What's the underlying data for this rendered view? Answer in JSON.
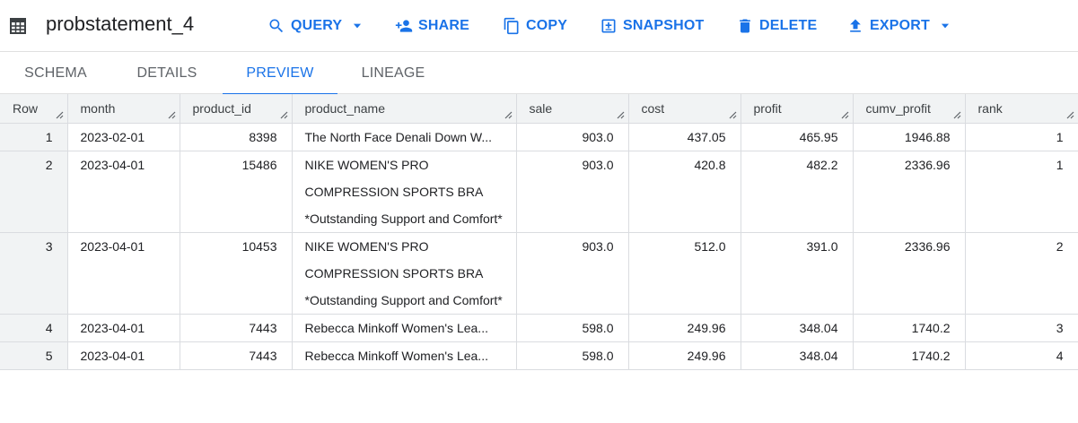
{
  "toolbar": {
    "title": "probstatement_4",
    "query_label": "QUERY",
    "share_label": "SHARE",
    "copy_label": "COPY",
    "snapshot_label": "SNAPSHOT",
    "delete_label": "DELETE",
    "export_label": "EXPORT"
  },
  "tabs": [
    {
      "label": "SCHEMA"
    },
    {
      "label": "DETAILS"
    },
    {
      "label": "PREVIEW",
      "active": true
    },
    {
      "label": "LINEAGE"
    }
  ],
  "colors": {
    "accent": "#1a73e8",
    "header_bg": "#f1f3f4"
  },
  "table": {
    "columns": [
      "Row",
      "month",
      "product_id",
      "product_name",
      "sale",
      "cost",
      "profit",
      "cumv_profit",
      "rank"
    ],
    "rows": [
      {
        "row": "1",
        "month": "2023-02-01",
        "product_id": "8398",
        "product_name": "The North Face Denali Down W...",
        "sale": "903.0",
        "cost": "437.05",
        "profit": "465.95",
        "cumv_profit": "1946.88",
        "rank": "1"
      },
      {
        "row": "2",
        "month": "2023-04-01",
        "product_id": "15486",
        "product_name": "NIKE WOMEN'S PRO COMPRESSION SPORTS BRA *Outstanding Support and Comfort*",
        "sale": "903.0",
        "cost": "420.8",
        "profit": "482.2",
        "cumv_profit": "2336.96",
        "rank": "1"
      },
      {
        "row": "3",
        "month": "2023-04-01",
        "product_id": "10453",
        "product_name": "NIKE WOMEN'S PRO COMPRESSION SPORTS BRA *Outstanding Support and Comfort*",
        "sale": "903.0",
        "cost": "512.0",
        "profit": "391.0",
        "cumv_profit": "2336.96",
        "rank": "2"
      },
      {
        "row": "4",
        "month": "2023-04-01",
        "product_id": "7443",
        "product_name": "Rebecca Minkoff Women's Lea...",
        "sale": "598.0",
        "cost": "249.96",
        "profit": "348.04",
        "cumv_profit": "1740.2",
        "rank": "3"
      },
      {
        "row": "5",
        "month": "2023-04-01",
        "product_id": "7443",
        "product_name": "Rebecca Minkoff Women's Lea...",
        "sale": "598.0",
        "cost": "249.96",
        "profit": "348.04",
        "cumv_profit": "1740.2",
        "rank": "4"
      }
    ]
  }
}
